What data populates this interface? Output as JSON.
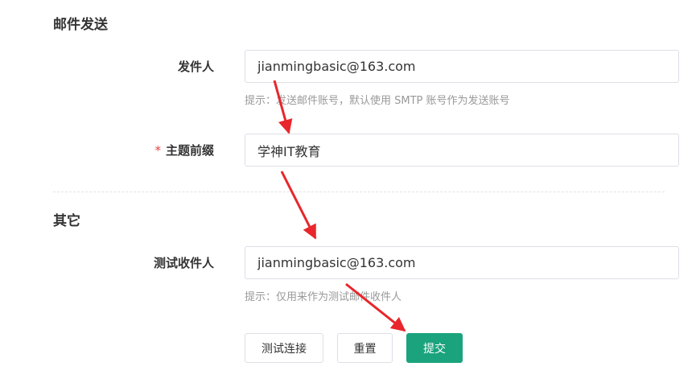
{
  "mail_section": {
    "title": "邮件发送",
    "sender": {
      "label": "发件人",
      "value": "jianmingbasic@163.com",
      "hint": "提示：发送邮件账号，默认使用 SMTP 账号作为发送账号"
    },
    "subject_prefix": {
      "required_mark": "*",
      "label": "主题前缀",
      "value": "学神IT教育"
    }
  },
  "other_section": {
    "title": "其它",
    "test_recipient": {
      "label": "测试收件人",
      "value": "jianmingbasic@163.com",
      "hint": "提示：仅用来作为测试邮件收件人"
    }
  },
  "actions": {
    "test_connection": "测试连接",
    "reset": "重置",
    "submit": "提交"
  },
  "colors": {
    "primary": "#1aa37d",
    "annotation_arrow": "#e8262b",
    "required": "#e64545"
  }
}
